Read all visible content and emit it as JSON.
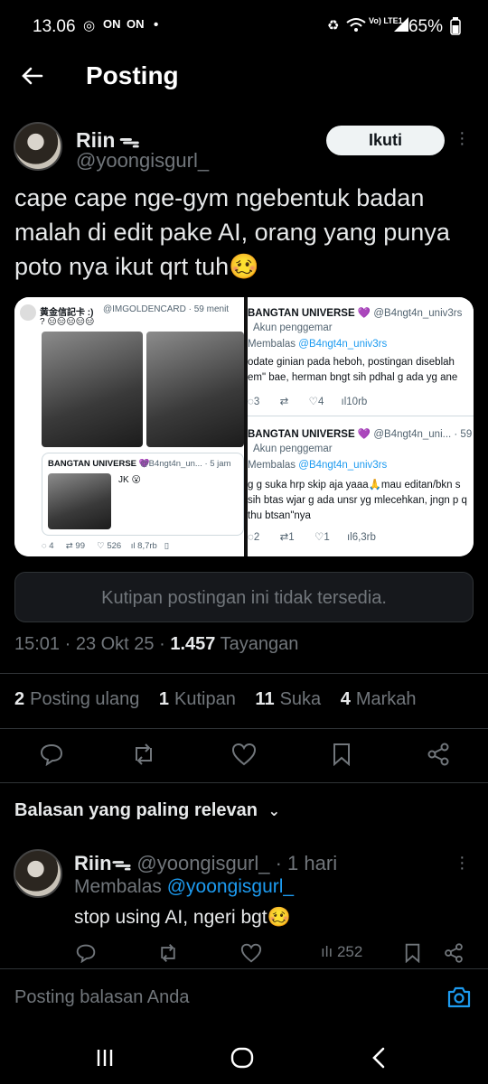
{
  "status_bar": {
    "time": "13.06",
    "battery": "65%",
    "icons": [
      "instagram-icon",
      "on-icon",
      "on-icon",
      "dot-icon",
      "battery-saver-icon",
      "wifi-icon",
      "volte-icon",
      "signal-icon",
      "battery-icon"
    ],
    "network_label": "Vo) LTE1"
  },
  "header": {
    "title": "Posting"
  },
  "post": {
    "author_name": "Riin",
    "author_handle": "@yoongisgurl_",
    "follow_label": "Ikuti",
    "text": "cape cape nge-gym ngebentuk badan malah di edit pake AI, orang yang punya poto nya ikut qrt tuh🥴",
    "media_left": {
      "account": "黄金信記卡 :)",
      "handle": "@IMGOLDENCARD · 59 menit",
      "body": "? 😑😑😑😑😑",
      "quoted_account": "BANGTAN UNIVERSE 💜",
      "quoted_handle": "@B4ngt4n_un... · 5 jam",
      "quoted_text": "JK 😮",
      "metrics": {
        "replies": "4",
        "reposts": "99",
        "likes": "526",
        "views": "8,7rb"
      }
    },
    "media_right": {
      "tweet1": {
        "account": "BANGTAN UNIVERSE 💜",
        "handle": "@B4ngt4n_univ3rs",
        "tag": "Akun penggemar",
        "reply_prefix": "Membalas",
        "reply_to": "@B4ngt4n_univ3rs",
        "text": "odate ginian pada heboh, postingan diseblah em\" bae, herman bngt sih pdhal g ada yg ane",
        "metrics": {
          "replies": "3",
          "reposts": "",
          "likes": "4",
          "views": "10rb"
        }
      },
      "tweet2": {
        "account": "BANGTAN UNIVERSE 💜",
        "handle": "@B4ngt4n_uni... · 59",
        "tag": "Akun penggemar",
        "reply_prefix": "Membalas",
        "reply_to": "@B4ngt4n_univ3rs",
        "text": "g g suka hrp skip aja yaaa🙏mau editan/bkn s sih btas wjar g ada unsr yg mlecehkan, jngn p q thu btsan\"nya",
        "metrics": {
          "replies": "2",
          "reposts": "1",
          "likes": "1",
          "views": "6,3rb"
        }
      }
    },
    "quote_unavailable": "Kutipan postingan ini tidak tersedia.",
    "timestamp": "15:01 · 23 Okt 25 · ",
    "views_count": "1.457",
    "views_label": "Tayangan",
    "stats": {
      "reposts_count": "2",
      "reposts_label": "Posting ulang",
      "quotes_count": "1",
      "quotes_label": "Kutipan",
      "likes_count": "11",
      "likes_label": "Suka",
      "bookmarks_count": "4",
      "bookmarks_label": "Markah"
    }
  },
  "replies_section": {
    "sort_label": "Balasan yang paling relevan",
    "reply": {
      "author_name": "Riin",
      "author_handle": "@yoongisgurl_",
      "time": "· 1 hari",
      "replying_prefix": "Membalas",
      "replying_to": "@yoongisgurl_",
      "text": "stop using AI, ngeri bgt🥴",
      "views": "252"
    }
  },
  "composer": {
    "placeholder": "Posting balasan Anda"
  },
  "colors": {
    "background": "#000000",
    "text": "#e7e9ea",
    "muted": "#71767b",
    "accent": "#1d9bf0",
    "border": "#2f3336"
  }
}
